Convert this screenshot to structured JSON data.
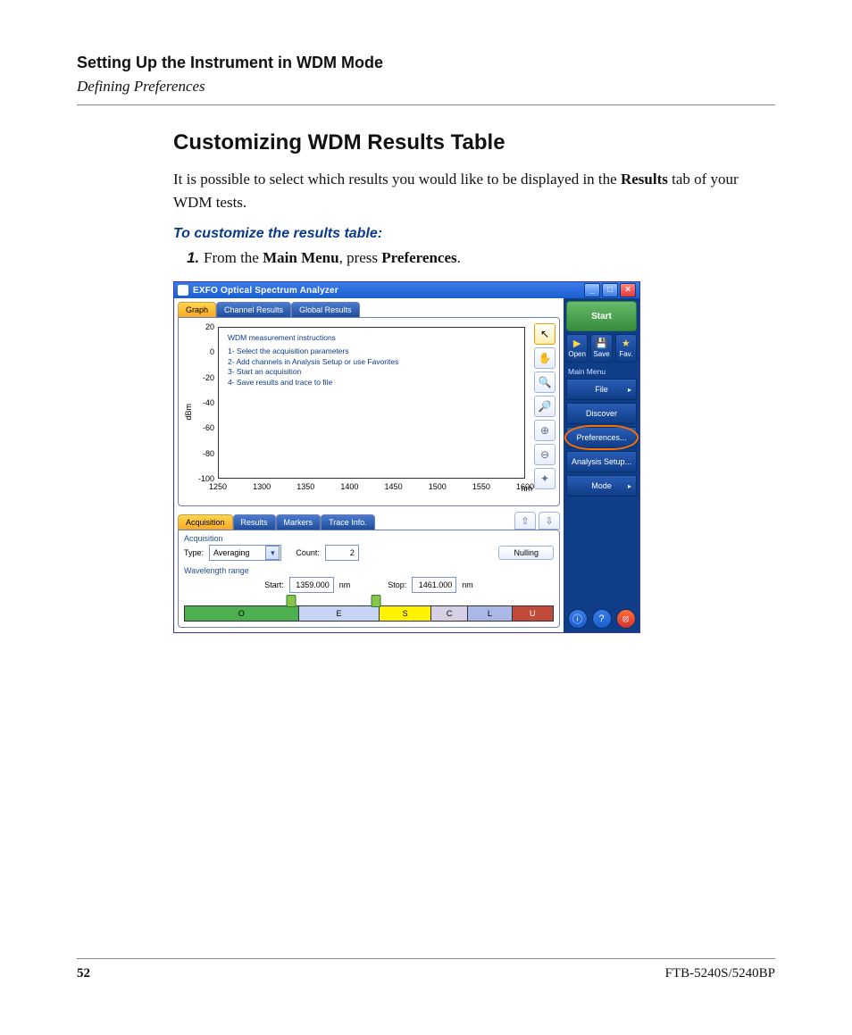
{
  "doc": {
    "chapter": "Setting Up the Instrument in WDM Mode",
    "subsection": "Defining Preferences",
    "heading": "Customizing WDM Results Table",
    "para_a": "It is possible to select which results you would like to be displayed in the ",
    "para_b_bold": "Results",
    "para_c": " tab of your WDM tests.",
    "task": "To customize the results table:",
    "step_a": "From the ",
    "step_b_bold": "Main Menu",
    "step_c": ", press ",
    "step_d_bold": "Preferences",
    "step_e": ".",
    "page_number": "52",
    "model": "FTB-5240S/5240BP"
  },
  "app": {
    "title": "EXFO Optical Spectrum Analyzer",
    "win_min": "_",
    "win_max": "□",
    "win_close": "×",
    "main_tabs": [
      "Graph",
      "Channel Results",
      "Global Results"
    ],
    "chart": {
      "ylabel": "dBm",
      "x_unit": "nm",
      "yticks": [
        "20",
        "0",
        "-20",
        "-40",
        "-60",
        "-80",
        "-100"
      ],
      "xticks": [
        "1250",
        "1300",
        "1350",
        "1400",
        "1450",
        "1500",
        "1550",
        "1600"
      ],
      "instr_title": "WDM measurement instructions",
      "instr_lines": [
        "1- Select the acquisition parameters",
        "2- Add channels in Analysis Setup or use Favorites",
        "3- Start an acquisition",
        "4- Save results and trace to file"
      ]
    },
    "tool_icons": [
      "↖",
      "✋",
      "🔍",
      "🔎",
      "⊕",
      "⊖",
      "✦"
    ],
    "bottom_tabs": [
      "Acquisition",
      "Results",
      "Markers",
      "Trace Info."
    ],
    "arrow_up": "⇧",
    "arrow_down": "⇩",
    "acq": {
      "legend": "Acquisition",
      "type_label": "Type:",
      "type_value": "Averaging",
      "count_label": "Count:",
      "count_value": "2",
      "nulling": "Nulling"
    },
    "wl": {
      "legend": "Wavelength range",
      "start_label": "Start:",
      "start_value": "1359.000",
      "stop_label": "Stop:",
      "stop_value": "1461.000",
      "unit": "nm",
      "bands": [
        {
          "label": "O",
          "color": "#4caf50",
          "w": 31,
          "fg": "#000"
        },
        {
          "label": "E",
          "color": "#c6d5f5",
          "w": 22,
          "fg": "#000"
        },
        {
          "label": "S",
          "color": "#fff200",
          "w": 14,
          "fg": "#000"
        },
        {
          "label": "C",
          "color": "#d6d0e4",
          "w": 10,
          "fg": "#000"
        },
        {
          "label": "L",
          "color": "#a9b8e6",
          "w": 12,
          "fg": "#000"
        },
        {
          "label": "U",
          "color": "#c24a3a",
          "w": 11,
          "fg": "#fff"
        }
      ]
    },
    "side": {
      "start": "Start",
      "open": "Open",
      "save": "Save",
      "fav": "Fav.",
      "menu_head": "Main Menu",
      "file": "File",
      "discover": "Discover",
      "preferences": "Preferences...",
      "analysis": "Analysis Setup...",
      "mode": "Mode",
      "arrow": "▸",
      "info_glyph": "ⓘ",
      "help_glyph": "?",
      "close_glyph": "⦻"
    }
  }
}
